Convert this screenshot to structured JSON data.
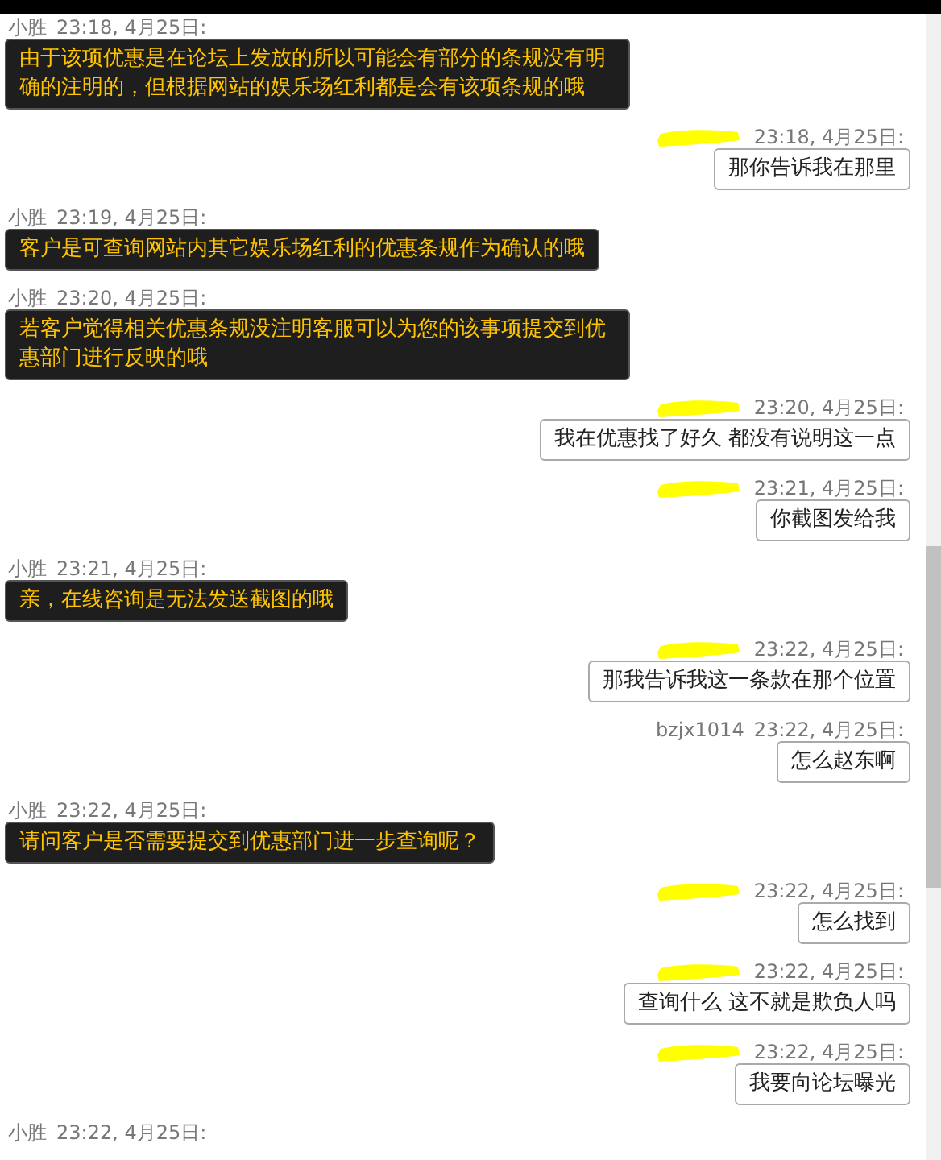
{
  "messages": [
    {
      "kind": "agent",
      "sender": "小胜",
      "time": "23:18, 4月25日:",
      "text": "由于该项优惠是在论坛上发放的所以可能会有部分的条规没有明确的注明的，但根据网站的娱乐场红利都是会有该项条规的哦"
    },
    {
      "kind": "user",
      "redacted": true,
      "time": "23:18, 4月25日:",
      "text": "那你告诉我在那里"
    },
    {
      "kind": "agent",
      "sender": "小胜",
      "time": "23:19, 4月25日:",
      "text": "客户是可查询网站内其它娱乐场红利的优惠条规作为确认的哦"
    },
    {
      "kind": "agent",
      "sender": "小胜",
      "time": "23:20, 4月25日:",
      "text": "若客户觉得相关优惠条规没注明客服可以为您的该事项提交到优惠部门进行反映的哦"
    },
    {
      "kind": "user",
      "redacted": true,
      "time": "23:20, 4月25日:",
      "text": "我在优惠找了好久 都没有说明这一点"
    },
    {
      "kind": "user",
      "redacted": true,
      "time": "23:21, 4月25日:",
      "text": "你截图发给我"
    },
    {
      "kind": "agent",
      "sender": "小胜",
      "time": "23:21, 4月25日:",
      "text": "亲，在线咨询是无法发送截图的哦"
    },
    {
      "kind": "user",
      "redacted": true,
      "time": "23:22, 4月25日:",
      "text": "那我告诉我这一条款在那个位置"
    },
    {
      "kind": "user",
      "redacted": false,
      "sender": "bzjx1014",
      "time": "23:22, 4月25日:",
      "text": "怎么赵东啊"
    },
    {
      "kind": "agent",
      "sender": "小胜",
      "time": "23:22, 4月25日:",
      "text": "请问客户是否需要提交到优惠部门进一步查询呢？"
    },
    {
      "kind": "user",
      "redacted": true,
      "time": "23:22, 4月25日:",
      "text": "怎么找到"
    },
    {
      "kind": "user",
      "redacted": true,
      "time": "23:22, 4月25日:",
      "text": "查询什么 这不就是欺负人吗"
    },
    {
      "kind": "user",
      "redacted": true,
      "time": "23:22, 4月25日:",
      "text": "我要向论坛曝光"
    },
    {
      "kind": "agent",
      "sender": "小胜",
      "time": "23:22, 4月25日:"
    }
  ]
}
